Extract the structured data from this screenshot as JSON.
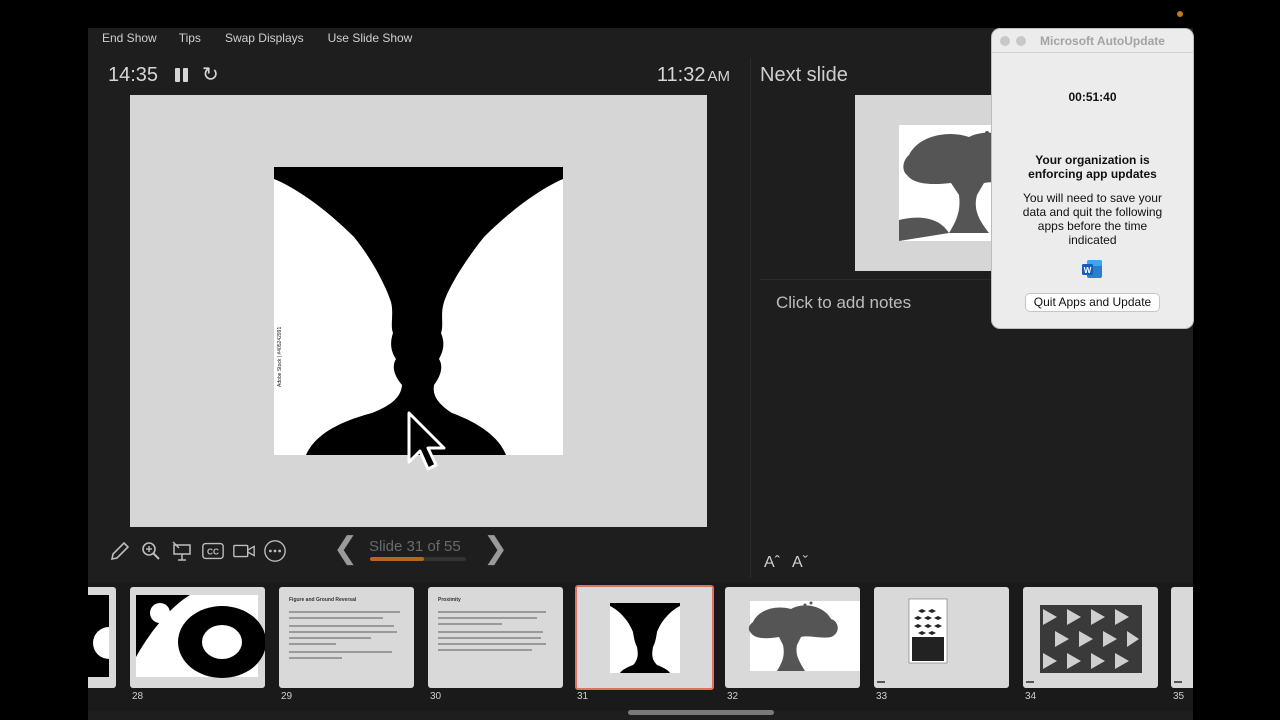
{
  "menu": [
    "End Show",
    "Tips",
    "Swap Displays",
    "Use Slide Show"
  ],
  "timer": {
    "elapsed": "14:35",
    "time": "11:32",
    "ampm": "AM"
  },
  "main_slide": {
    "stock_tag": "Adobe Stock | #405242991"
  },
  "navigation": {
    "counter": "Slide 31 of 55",
    "progress_percent": 56
  },
  "next": {
    "title": "Next slide"
  },
  "notes": {
    "placeholder": "Click to add notes"
  },
  "font_controls": {
    "increase": "Aˆ",
    "decrease": "Aˇ"
  },
  "filmstrip": {
    "slides": [
      {
        "number": "28",
        "kind": "circles"
      },
      {
        "number": "29",
        "kind": "text",
        "heading": "Figure and Ground Reversal"
      },
      {
        "number": "30",
        "kind": "text",
        "heading": "Proximity"
      },
      {
        "number": "31",
        "kind": "vase",
        "current": true
      },
      {
        "number": "32",
        "kind": "tree"
      },
      {
        "number": "33",
        "kind": "escher"
      },
      {
        "number": "34",
        "kind": "tiles"
      },
      {
        "number": "35",
        "kind": "partial"
      }
    ]
  },
  "autoupdate": {
    "title": "Microsoft AutoUpdate",
    "countdown": "00:51:40",
    "heading": "Your organization is enforcing app updates",
    "message": "You will need to save your data and quit the following apps before the time indicated",
    "button": "Quit Apps and Update"
  },
  "icons": [
    "pen-icon",
    "zoom-icon",
    "laser-pointer-icon",
    "subtitles-icon",
    "camera-icon",
    "more-icon",
    "pause-icon",
    "reset-icon"
  ]
}
